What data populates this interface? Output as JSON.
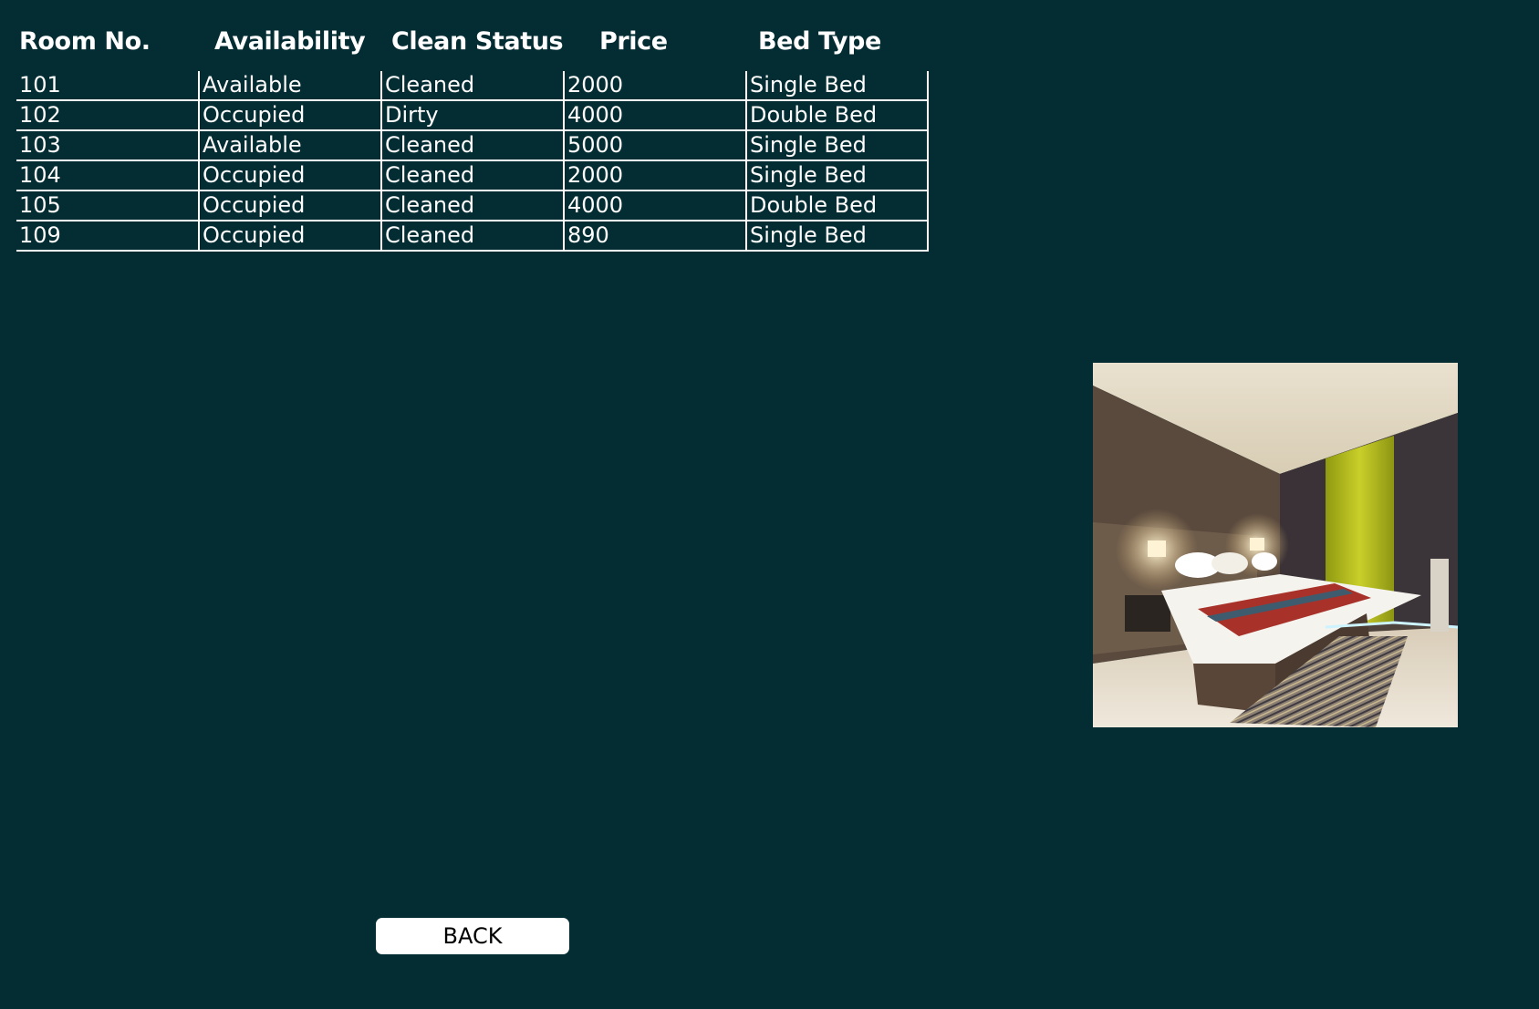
{
  "table": {
    "headers": [
      "Room No.",
      "Availability",
      "Clean Status",
      "Price",
      "Bed Type"
    ],
    "rows": [
      [
        "101",
        "Available",
        "Cleaned",
        "2000",
        "Single Bed"
      ],
      [
        "102",
        "Occupied",
        "Dirty",
        "4000",
        "Double Bed"
      ],
      [
        "103",
        "Available",
        "Cleaned",
        "5000",
        "Single Bed"
      ],
      [
        "104",
        "Occupied",
        "Cleaned",
        "2000",
        "Single Bed"
      ],
      [
        "105",
        "Occupied",
        "Cleaned",
        "4000",
        "Double Bed"
      ],
      [
        "109",
        "Occupied",
        "Cleaned",
        "890",
        "Single Bed"
      ]
    ]
  },
  "back_button": {
    "label": "BACK"
  },
  "image": {
    "subject": "hotel-room-bedroom-photo"
  },
  "colors": {
    "background": "#032c33",
    "text": "#ffffff",
    "grid": "#ffffff",
    "button_bg": "#ffffff",
    "button_text": "#000000"
  }
}
